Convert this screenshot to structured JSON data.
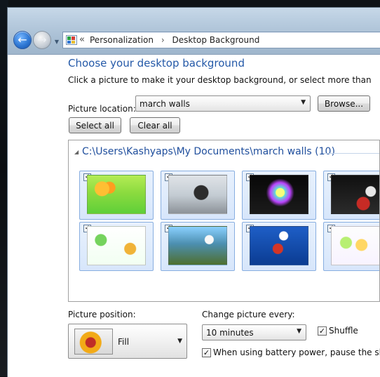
{
  "window": {
    "navigation": {
      "back_icon": "back-arrow-icon",
      "forward_icon": "forward-arrow-icon",
      "history_icon": "dropdown-arrow-icon"
    },
    "address_bar": {
      "icon": "control-panel-icon",
      "overflow_symbol": "«",
      "breadcrumbs": [
        "Personalization",
        "Desktop Background"
      ]
    }
  },
  "page": {
    "title": "Choose your desktop background",
    "description": "Click a picture to make it your desktop background, or select more than one pictur"
  },
  "picture_location": {
    "label": "Picture location:",
    "value": "march walls",
    "browse_label": "Browse..."
  },
  "actions": {
    "select_all": "Select all",
    "clear_all": "Clear all"
  },
  "gallery": {
    "group_toggle": "◢",
    "group_title": "C:\\Users\\Kashyaps\\My Documents\\march walls (10)",
    "thumbnail_check_mark": "✓",
    "thumbnails": [
      {
        "name": "wallpaper-1",
        "checked": true
      },
      {
        "name": "wallpaper-2",
        "checked": true
      },
      {
        "name": "wallpaper-3",
        "checked": true
      },
      {
        "name": "wallpaper-4",
        "checked": true
      },
      {
        "name": "wallpaper-5",
        "checked": true
      },
      {
        "name": "wallpaper-6",
        "checked": true
      },
      {
        "name": "wallpaper-7",
        "checked": true
      },
      {
        "name": "wallpaper-8",
        "checked": true
      }
    ]
  },
  "picture_position": {
    "label": "Picture position:",
    "value": "Fill"
  },
  "change_picture": {
    "label": "Change picture every:",
    "value": "10 minutes",
    "shuffle_label": "Shuffle",
    "shuffle_checked": true
  },
  "battery": {
    "label": "When using battery power, pause the slide s",
    "checked": true
  }
}
